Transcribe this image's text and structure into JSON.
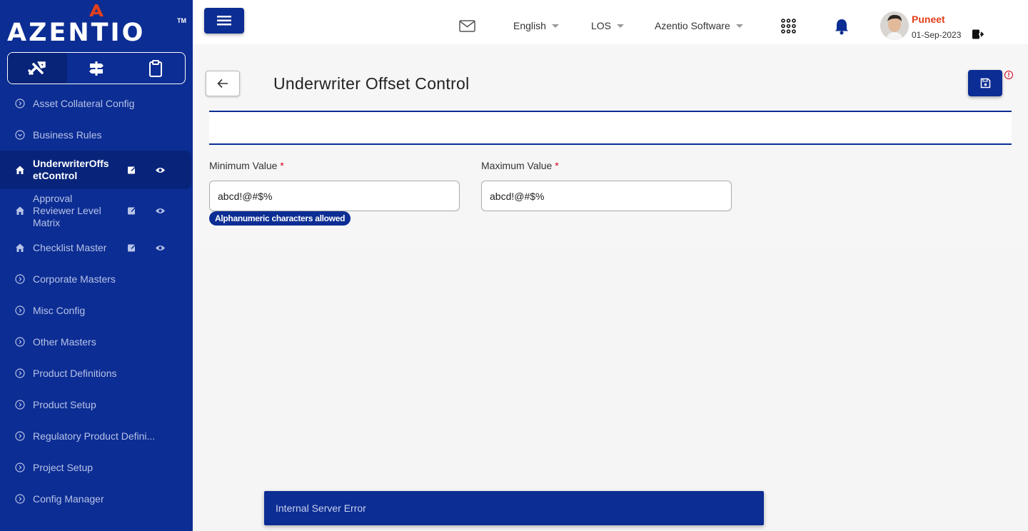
{
  "brand": {
    "logo_text": "AZENTIO",
    "trademark": "TM"
  },
  "sidebar": {
    "tabs": [
      {
        "icon": "tools-icon",
        "active": true
      },
      {
        "icon": "signpost-icon",
        "active": false
      },
      {
        "icon": "clipboard-icon",
        "active": false
      }
    ],
    "items": [
      {
        "label": "Asset Collateral Config"
      },
      {
        "label": "Business Rules"
      },
      {
        "label": "UnderwriterOffsetControl",
        "active": true
      },
      {
        "label": "Approval Reviewer Level Matrix"
      },
      {
        "label": "Checklist Master"
      },
      {
        "label": "Corporate Masters"
      },
      {
        "label": "Misc Config"
      },
      {
        "label": "Other Masters"
      },
      {
        "label": "Product Definitions"
      },
      {
        "label": "Product Setup"
      },
      {
        "label": "Regulatory Product Defini..."
      },
      {
        "label": "Project Setup"
      },
      {
        "label": "Config Manager"
      }
    ]
  },
  "header": {
    "language": "English",
    "module": "LOS",
    "company": "Azentio Software",
    "user": {
      "name": "Puneet",
      "date": "01-Sep-2023"
    }
  },
  "page": {
    "title": "Underwriter Offset Control",
    "min_label": "Minimum Value",
    "max_label": "Maximum Value",
    "required_mark": "*",
    "min_value": "abcd!@#$%",
    "max_value": "abcd!@#$%",
    "hint": "Alphanumeric characters allowed",
    "error_indicator": "!"
  },
  "toast": {
    "message": "Internal Server Error"
  },
  "colors": {
    "primary": "#0c2d93",
    "accent_user": "#e2401c",
    "required": "#d0021b"
  }
}
